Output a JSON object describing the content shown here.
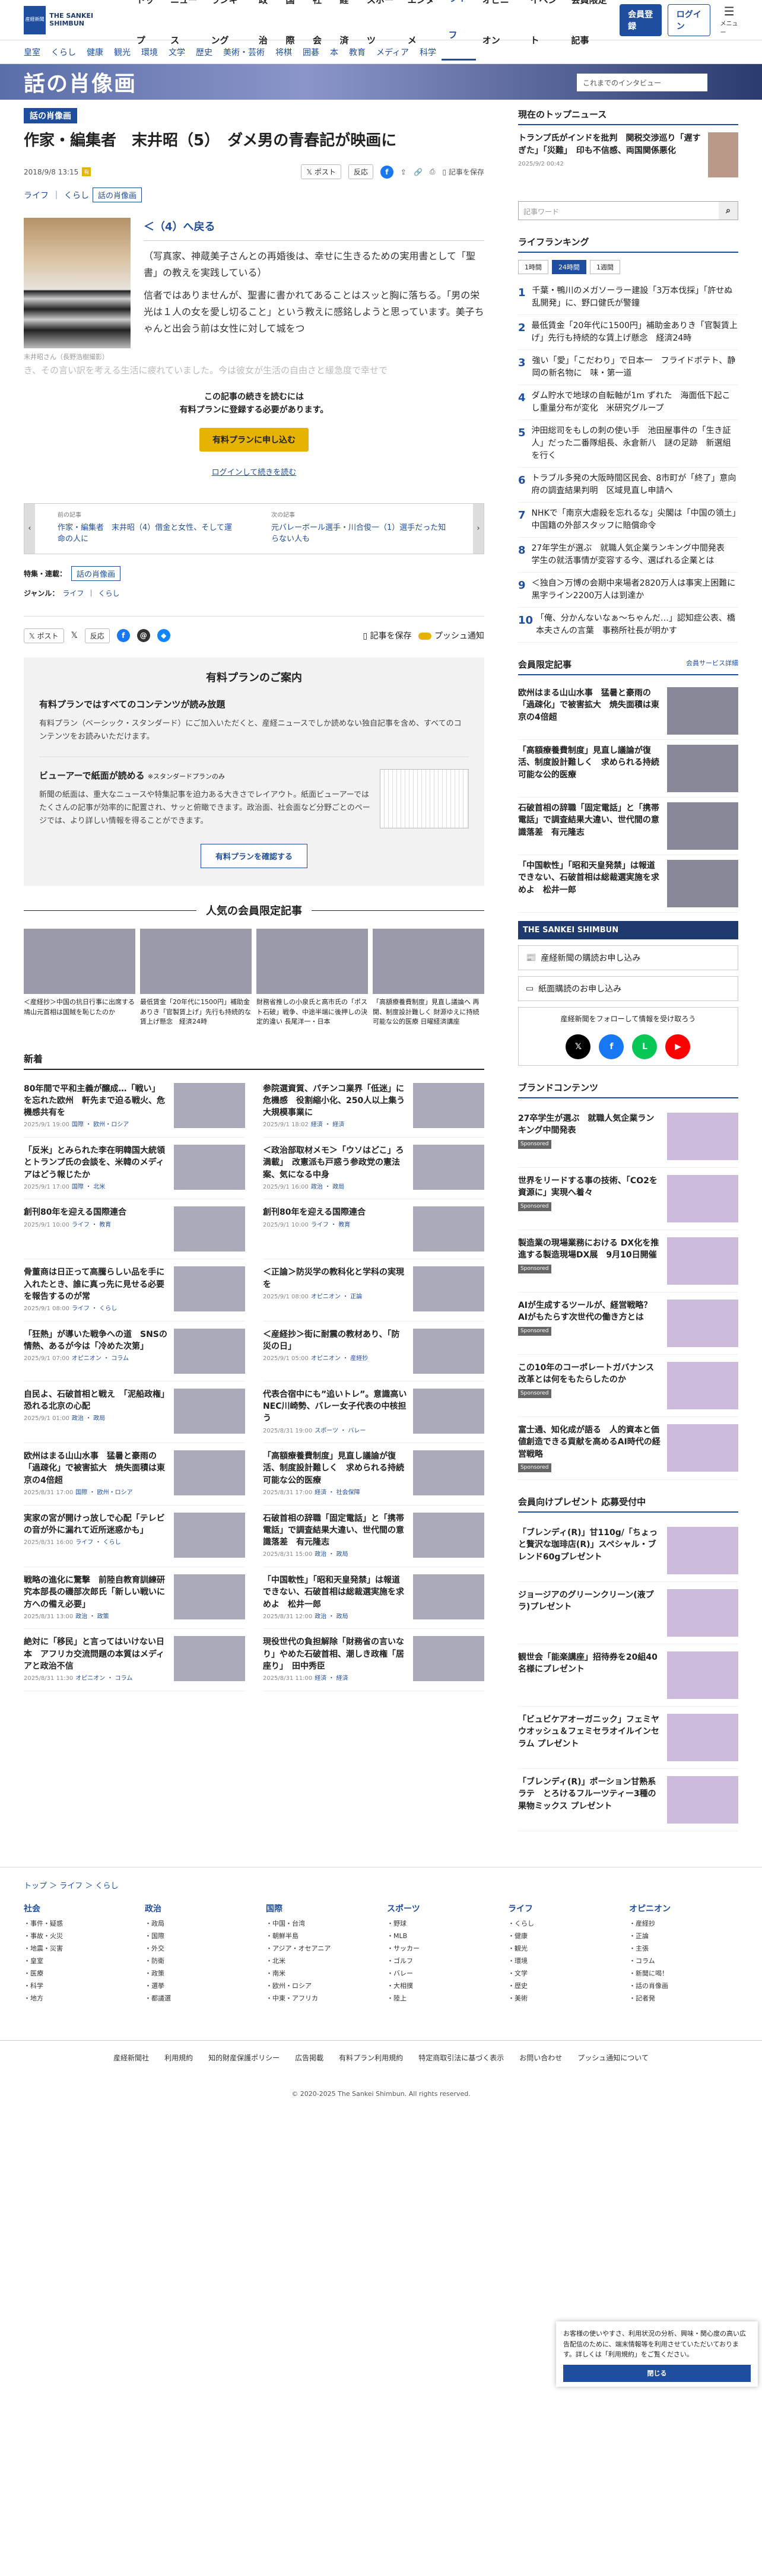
{
  "logo": {
    "line1": "産経新聞",
    "line2": "THE SANKEI SHIMBUN"
  },
  "gnav": [
    "トップ",
    "ニュース",
    "ランキング",
    "政治",
    "国際",
    "社会",
    "経済",
    "スポーツ",
    "エンタメ",
    "ライフ",
    "オピニオン",
    "イベント",
    "会員限定記事"
  ],
  "gnav_current": "ライフ",
  "header": {
    "register": "会員登録",
    "login": "ログイン",
    "menu": "メニュー"
  },
  "subnav": [
    "皇室",
    "くらし",
    "健康",
    "観光",
    "環境",
    "文学",
    "歴史",
    "美術・芸術",
    "将棋",
    "囲碁",
    "本",
    "教育",
    "メディア",
    "科学"
  ],
  "banner": {
    "title": "話の肖像画",
    "quote": "これまでのインタビュー"
  },
  "article": {
    "tag": "話の肖像画",
    "title": "作家・編集者　末井昭（5）　ダメ男の青春記が映画に",
    "date": "2018/9/8 13:15",
    "post": "ポスト",
    "react": "反応",
    "save": "記事を保存",
    "crumb": "ライフ",
    "crumb2": "くらし",
    "tag2": "話の肖像画",
    "caption": "末井昭さん（長野浩樹撮影）",
    "link": "＜（4）へ戻る",
    "p1": "（写真家、神蔵美子さんとの再婚後は、幸せに生きるための実用書として「聖書」の教えを実践している）",
    "p2": "信者ではありませんが、聖書に書かれてあることはスッと胸に落ちる。「男の栄光は１人の女を愛し切ること」という教えに感銘しようと思っています。美子ちゃんと出会う前は女性に対して城をつ",
    "p3": "き、その言い訳を考える生活に疲れていました。今は彼女が生活の自由さと緩急度で幸せで",
    "pay1": "この記事の続きを読むには",
    "pay2": "有料プランに登録する必要があります。",
    "pay_btn": "有料プランに申し込む",
    "pay_login": "ログインして続きを読む",
    "prev_label": "前の記事",
    "prev": "作家・編集者　末井昭（4）借金と女性、そして運命の人に",
    "next_label": "次の記事",
    "next": "元バレーボール選手・川合俊一（1）選手だった知らない人も",
    "feature_label": "特集・連載：",
    "feature": "話の肖像画",
    "genre_label": "ジャンル：",
    "genre": "ライフ",
    "genre2": "くらし",
    "push": "プッシュ通知"
  },
  "plan": {
    "head": "有料プランのご案内",
    "h1": "有料プランではすべてのコンテンツが読み放題",
    "p1": "有料プラン（ベーシック・スタンダード）にご加入いただくと、産経ニュースでしか読めない独自記事を含め、すべてのコンテンツをお読みいただけます。",
    "h2": "ビューアーで紙面が読める",
    "h2s": "※スタンダードプランのみ",
    "p2": "新聞の紙面は、重大なニュースや特集記事を迫力ある大きさでレイアウト。紙面ビューアーではたくさんの記事が効率的に配置され、サッと俯瞰できます。政治面、社会面など分野ごとのページでは、より詳しい情報を得ることができます。",
    "btn": "有料プランを確認する"
  },
  "popular": {
    "head": "人気の会員限定記事",
    "items": [
      "＜産経抄＞中国の抗日行事に出席する鳩山元首相は国賊を恥じたのか",
      "最低賃金「20年代に1500円」補助金ありき「官製賃上げ」先行も持続的な賃上げ懸念　経済24時",
      "財務省推しの小泉氏と高市氏の「ポスト石破」戦争、中途半端に後押しの決定的違い 長尾洋一・日本",
      "「高額療養費制度」見直し議論へ 再開、制度設計難しく 財源ゆえに持続可能な公的医療 日曜経済講座"
    ]
  },
  "news": {
    "head": "新着",
    "items": [
      {
        "t": "80年間で平和主義が醸成…「戦い」を忘れた欧州　軒先まで迫る戦火、危機感共有を",
        "d": "2025/9/1 19:00",
        "c": "国際",
        "c2": "欧州・ロシア"
      },
      {
        "t": "参院選資質、パチンコ業界「低迷」に危機感　役割縮小化、250人以上集う大規模事業に",
        "d": "2025/9/1 18:02",
        "c": "経済",
        "c2": "経済"
      },
      {
        "t": "「反米」とみられた李在明韓国大統領とトランプ氏の会談を、米韓のメディアはどう報じたか",
        "d": "2025/9/1 17:00",
        "c": "国際",
        "c2": "北米"
      },
      {
        "t": "＜政治部取材メモ＞「ウソはどこ」ろ満載」　改憲派も戸惑う参政党の憲法案、気になる中身",
        "d": "2025/9/1 16:00",
        "c": "政治",
        "c2": "政局"
      },
      {
        "t": "創刊80年を迎える国際連合",
        "d": "2025/9/1 10:00",
        "c": "ライフ",
        "c2": "教育"
      },
      {
        "t": "創刊80年を迎える国際連合",
        "d": "2025/9/1 10:00",
        "c": "ライフ",
        "c2": "教育"
      },
      {
        "t": "骨董商は日正って高騰らしい品を手に入れたとき、誰に真っ先に見せる必要を報告するのが常",
        "d": "2025/9/1 08:00",
        "c": "ライフ",
        "c2": "くらし"
      },
      {
        "t": "＜正論＞防災学の教科化と学科の実現を",
        "d": "2025/9/1 08:00",
        "c": "オピニオン",
        "c2": "正論"
      },
      {
        "t": "「狂熱」が導いた戦争への道　SNSの情熱、あるが今は「冷めた次第」",
        "d": "2025/9/1 07:00",
        "c": "オピニオン",
        "c2": "コラム"
      },
      {
        "t": "＜産経抄＞街に耐震の教材あり、「防災の日」",
        "d": "2025/9/1 05:00",
        "c": "オピニオン",
        "c2": "産経抄"
      },
      {
        "t": "自民よ、石破首相と戦え　「泥船政権」恐れる北京の心配",
        "d": "2025/9/1 01:00",
        "c": "政治",
        "c2": "政局"
      },
      {
        "t": "代表合宿中にも”追いトレ”。意識高いNEC川崎勢、バレー女子代表の中核担う",
        "d": "2025/8/31 19:00",
        "c": "スポーツ",
        "c2": "バレー"
      },
      {
        "t": "欧州はまる山山水事　猛暑と豪雨の「過疎化」で被害拡大　焼失面積は東京の4倍超",
        "d": "2025/8/31 17:00",
        "c": "国際",
        "c2": "欧州・ロシア"
      },
      {
        "t": "「高額療養費制度」見直し議論が復活、制度設計難しく　求められる持続可能な公的医療",
        "d": "2025/8/31 17:00",
        "c": "経済",
        "c2": "社会保障"
      },
      {
        "t": "実家の宮が開けっ放しで心配「テレビの音が外に漏れて近所迷惑かも」",
        "d": "2025/8/31 16:00",
        "c": "ライフ",
        "c2": "くらし"
      },
      {
        "t": "石破首相の辞職「固定電話」と「携帯電話」で調査結果大違い、世代間の意識落差　有元隆志",
        "d": "2025/8/31 15:00",
        "c": "政治",
        "c2": "政局"
      },
      {
        "t": "戦略の進化に驚撃　前陸自教育訓練研究本部長の磯部次郎氏「新しい戦いに方への備え必要」",
        "d": "2025/8/31 13:00",
        "c": "政治",
        "c2": "政策"
      },
      {
        "t": "「中国軟性」「昭和天皇発禁」は報道できない、石破首相は総裁選実施を求めよ　松井一郎",
        "d": "2025/8/31 12:00",
        "c": "政治",
        "c2": "政局"
      },
      {
        "t": "絶対に「移民」と言ってはいけない日本　アフリカ交流問題の本質はメディアと政治不信",
        "d": "2025/8/31 11:30",
        "c": "オピニオン",
        "c2": "コラム"
      },
      {
        "t": "現役世代の負担解除「財務省の言いなり」やめた石破首相、潮しき政権「居座り」　田中秀臣",
        "d": "2025/8/31 11:00",
        "c": "経済",
        "c2": "経済"
      }
    ]
  },
  "right": {
    "topnews_head": "現在のトップニュース",
    "topnews": "トランプ氏がインドを批判　関税交渉巡り「遅すぎた」「災難」　印も不信感、両国関係悪化",
    "topnews_date": "2025/9/2 00:42",
    "search_ph": "記事ワード",
    "ranking_head": "ライフランキング",
    "tabs": [
      "1時間",
      "24時間",
      "1週間"
    ],
    "ranking": [
      "千葉・鴨川のメガソーラー建設「3万本伐採」「許せぬ乱開発」に、野口健氏が警鐘",
      "最低賃金「20年代に1500円」補助金ありき「官製賃上げ」先行も持続的な賃上げ懸念　経済24時",
      "強い「愛」「こだわり」で日本一　フライドポテト、静岡の新名物に　味・第一道",
      "ダム貯水で地球の自転軸が1m ずれた　海面低下起こし重量分布が変化　米研究グループ",
      "沖田総司をもしの刺の使い手　池田屋事件の「生き証人」だった二番隊組長、永倉新八　謎の足跡　新選組を行く",
      "トラブル多発の大阪時間区民会、8市町が「終了」意向　府の調査結果判明　区域見直し申請へ",
      "NHKで「南京大虐殺を忘れるな」尖閣は「中国の領土」　中国籍の外部スタッフに賠償命令",
      "27年学生が選ぶ　就職人気企業ランキング中間発表　学生の就活事情が変容する今、選ばれる企業とは",
      "＜独自＞万博の会期中来場者2820万人は事実上困難に　黒字ライン2200万人は到達か",
      "「俺、分かんないなぁ～ちゃんだ…」認知症公表、橋本夫さんの言葉　事務所社長が明かす"
    ],
    "member_head": "会員限定記事",
    "member_more": "会員サービス詳細",
    "member": [
      "欧州はまる山山水事　猛暑と豪雨の「過疎化」で被害拡大　焼失面積は東京の4倍超",
      "「高額療養費制度」見直し議論が復活、制度設計難しく　求められる持続可能な公的医療",
      "石破首相の辞職「固定電話」と「携帯電話」で調査結果大違い、世代間の意識落差　有元隆志",
      "「中国軟性」「昭和天皇発禁」は報道できない、石破首相は総裁選実施を求めよ　松井一郎"
    ],
    "sankei_banner": "THE SANKEI SHIMBUN",
    "paper_apply": "産経新聞の購読お申し込み",
    "viewer_apply": "紙面購読のお申し込み",
    "follow": "産経新聞をフォローして情報を受け取ろう",
    "brand_head": "ブランドコンテンツ",
    "sponsored": "Sponsored",
    "brand": [
      "27卒学生が選ぶ　就職人気企業ランキング中間発表",
      "世界をリードする事の技術、「CO2を資源に」実現へ着々",
      "製造業の現場業務における DX化を推進する製造現場DX展　9月10日開催",
      "AIが生成するツールが、経営戦略？AIがもたらす次世代の働き方とは",
      "この10年のコーポレートガバナンス改革とは何をもたらしたのか",
      "富士通、知化成が語る　人的資本と価値創造できる貢献を高めるAI時代の経営戦略"
    ],
    "present_head": "会員向けプレゼント 応募受付中",
    "present": [
      "「ブレンディ(R)」甘110g/「ちょっと贅沢な珈琲店(R)」スペシャル・ブレンド60gプレゼント",
      "ジョージアのグリーンクリーン(液プラ)プレゼント",
      "観世会「能楽講座」招待券を20組40名様にプレゼント",
      "「ビュビケアオーガニック」フェミヤウオッシュ＆フェミセラオイルインセラム プレゼント",
      "「ブレンディ(R)」ポーション甘熟系ラテ　とろけるフルーツティー3種の果物ミックス プレゼント"
    ]
  },
  "footer": {
    "bread": "トップ ＞ ライフ ＞ くらし",
    "cols": [
      {
        "h": "社会",
        "items": [
          "事件・疑惑",
          "事故・火災",
          "地震・災害",
          "皇室",
          "医療",
          "科学",
          "地方"
        ]
      },
      {
        "h": "政治",
        "items": [
          "政局",
          "国際",
          "外交",
          "防衛",
          "政策",
          "選挙",
          "都議選"
        ]
      },
      {
        "h": "国際",
        "items": [
          "中国・台湾",
          "朝鮮半島",
          "アジア・オセアニア",
          "北米",
          "南米",
          "欧州・ロシア",
          "中東・アフリカ"
        ]
      },
      {
        "h": "スポーツ",
        "items": [
          "野球",
          "MLB",
          "サッカー",
          "ゴルフ",
          "バレー",
          "大相撲",
          "陸上"
        ]
      },
      {
        "h": "ライフ",
        "items": [
          "くらし",
          "健康",
          "観光",
          "環境",
          "文学",
          "歴史",
          "美術"
        ]
      },
      {
        "h": "オピニオン",
        "items": [
          "産経抄",
          "正論",
          "主張",
          "コラム",
          "新聞に喝！",
          "話の肖像画",
          "記者発"
        ]
      }
    ],
    "links": [
      "産経新聞社",
      "利用規約",
      "知的財産保護ポリシー",
      "広告掲載",
      "有料プラン利用規約",
      "特定商取引法に基づく表示",
      "お問い合わせ",
      "プッシュ通知について"
    ],
    "copy": "© 2020-2025 The Sankei Shimbun. All rights reserved."
  },
  "cookie": {
    "text": "お客様の使いやすさ、利用状況の分析、興味・関心度の高い広告配信のために、端末情報等を利用させていただいております。詳しくは「利用規約」をご覧ください。",
    "btn": "閉じる"
  }
}
